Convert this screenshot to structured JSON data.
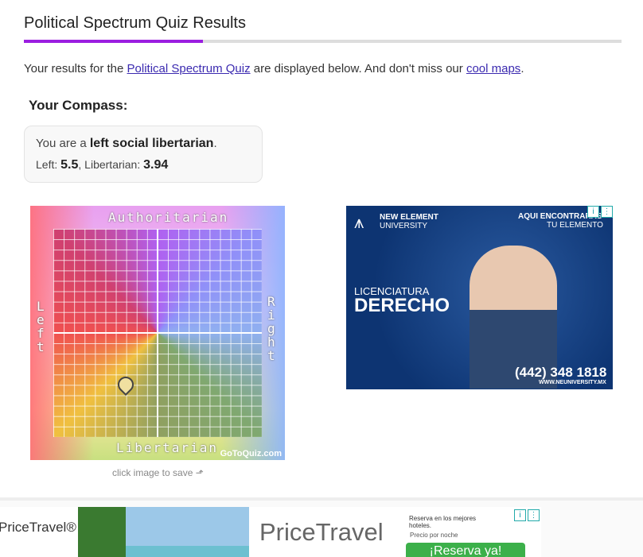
{
  "header": {
    "title": "Political Spectrum Quiz Results",
    "progress_percent": 30
  },
  "intro": {
    "before": "Your results for the ",
    "quiz_link": "Political Spectrum Quiz",
    "middle": " are displayed below. And don't miss our ",
    "maps_link": "cool maps",
    "after": "."
  },
  "compass_heading": "Your Compass:",
  "result": {
    "prefix": "You are a ",
    "label": "left social libertarian",
    "suffix": ".",
    "left_label": "Left: ",
    "left_value": "5.5",
    "sep": ", ",
    "lib_label": "Libertarian: ",
    "lib_value": "3.94"
  },
  "compass": {
    "top": "Authoritarian",
    "bottom": "Libertarian",
    "left": "Left",
    "right": "Right",
    "watermark": "GoToQuiz.com",
    "caption": "click image to save ⬏"
  },
  "ad1": {
    "brand": "NEW ELEMENT",
    "brand2": "UNIVERSITY",
    "tag1": "AQUI ENCONTRARAS",
    "tag2": "TU ELEMENTO",
    "sub": "LICENCIATURA",
    "main": "DERECHO",
    "phone": "(442) 348 1818",
    "url": "WWW.NEUNIVERSITY.MX"
  },
  "ad2": {
    "logo": "PriceTravel®",
    "brand": "PriceTravel",
    "line1": "Reserva en los mejores hoteles.",
    "line2": "Precio por noche",
    "cta": "¡Reserva ya!"
  }
}
